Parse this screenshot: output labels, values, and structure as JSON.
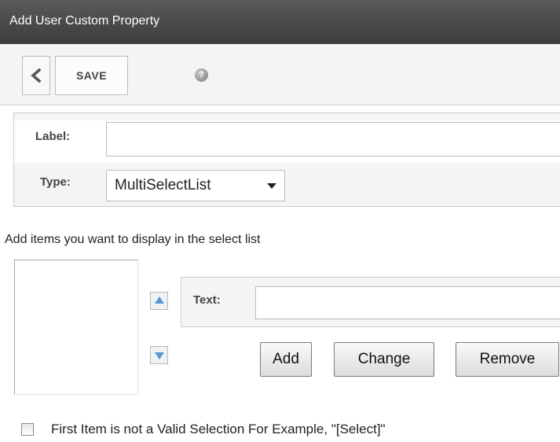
{
  "window": {
    "title": "Add User Custom Property"
  },
  "toolbar": {
    "back_icon": "chevron-left-icon",
    "save_label": "SAVE",
    "help_icon": "question-icon",
    "help_glyph": "?"
  },
  "form": {
    "label_caption": "Label:",
    "label_value": "",
    "type_caption": "Type:",
    "type_value": "MultiSelectList"
  },
  "items": {
    "instruction": "Add items you want to display in the select list",
    "list": [],
    "move_up_icon": "arrow-up-icon",
    "move_down_icon": "arrow-down-icon",
    "text_caption": "Text:",
    "text_value": "",
    "add_label": "Add",
    "change_label": "Change",
    "remove_label": "Remove"
  },
  "options": {
    "first_item_invalid_label": "First Item is not a Valid Selection For Example, \"[Select]\"",
    "first_item_invalid_checked": false
  },
  "colors": {
    "titlebar": "#484848",
    "arrow_accent": "#5a95d6"
  }
}
